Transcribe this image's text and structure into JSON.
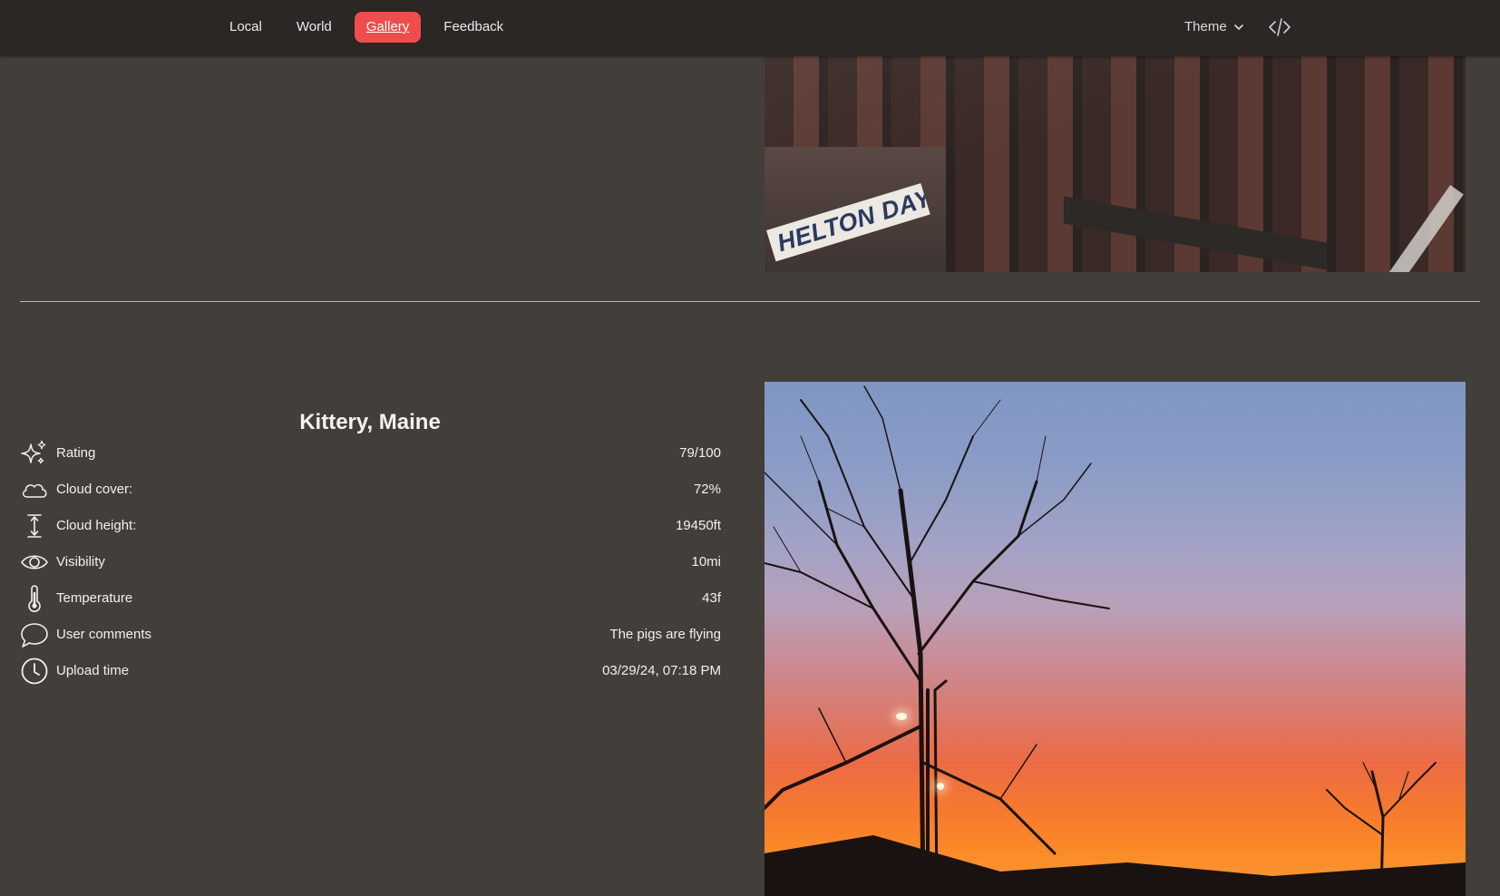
{
  "nav": {
    "links": [
      "Local",
      "World",
      "Gallery",
      "Feedback"
    ],
    "active": "Gallery",
    "theme_label": "Theme",
    "accent_color": "#ef4c4c"
  },
  "top_photo": {
    "banner_text": "HELTON DAY"
  },
  "entry": {
    "title": "Kittery, Maine",
    "stats": [
      {
        "icon": "sparkles-icon",
        "label": "Rating",
        "value": "79/100"
      },
      {
        "icon": "cloud-icon",
        "label": "Cloud cover:",
        "value": "72%"
      },
      {
        "icon": "height-arrow-icon",
        "label": "Cloud height:",
        "value": "19450ft"
      },
      {
        "icon": "eye-icon",
        "label": "Visibility",
        "value": "10mi"
      },
      {
        "icon": "thermometer-icon",
        "label": "Temperature",
        "value": "43f"
      },
      {
        "icon": "chat-bubble-icon",
        "label": "User comments",
        "value": "The pigs are flying"
      },
      {
        "icon": "clock-icon",
        "label": "Upload time",
        "value": "03/29/24, 07:18 PM"
      }
    ]
  }
}
